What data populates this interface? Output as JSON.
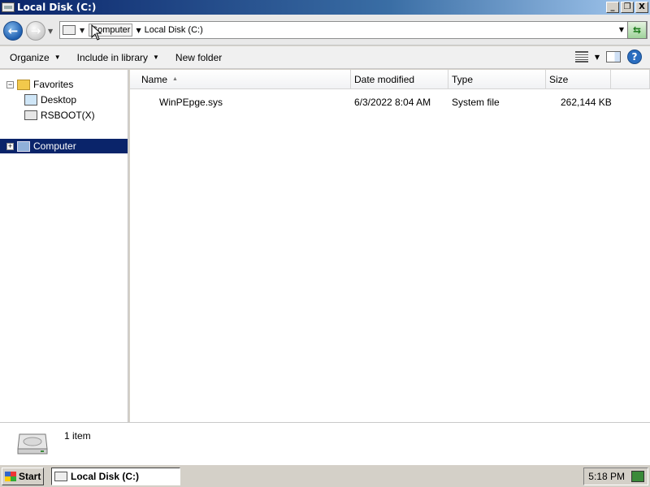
{
  "window": {
    "title": "Local Disk (C:)",
    "buttons": {
      "minimize": "_",
      "restore": "❐",
      "close": "X"
    }
  },
  "address": {
    "crumbs": [
      "Computer",
      "Local Disk (C:)"
    ],
    "icons": {
      "back": "back-arrow-icon",
      "forward": "forward-arrow-icon",
      "refresh": "refresh-icon"
    }
  },
  "toolbar": {
    "organize": "Organize",
    "include_in_library": "Include in library",
    "new_folder": "New folder",
    "help": "?"
  },
  "navigation": {
    "favorites": "Favorites",
    "desktop": "Desktop",
    "rsboot": "RSBOOT(X)",
    "computer": "Computer"
  },
  "columns": {
    "name": "Name",
    "date_modified": "Date modified",
    "type": "Type",
    "size": "Size"
  },
  "files": [
    {
      "name": "WinPEpge.sys",
      "date_modified": "6/3/2022 8:04 AM",
      "type": "System file",
      "size": "262,144 KB"
    }
  ],
  "details": {
    "item_count": "1 item"
  },
  "taskbar": {
    "start": "Start",
    "task": "Local Disk (C:)",
    "clock": "5:18 PM"
  },
  "colors": {
    "selection": "#0a246a",
    "title_gradient_start": "#0a246a",
    "title_gradient_end": "#a6caf0"
  }
}
